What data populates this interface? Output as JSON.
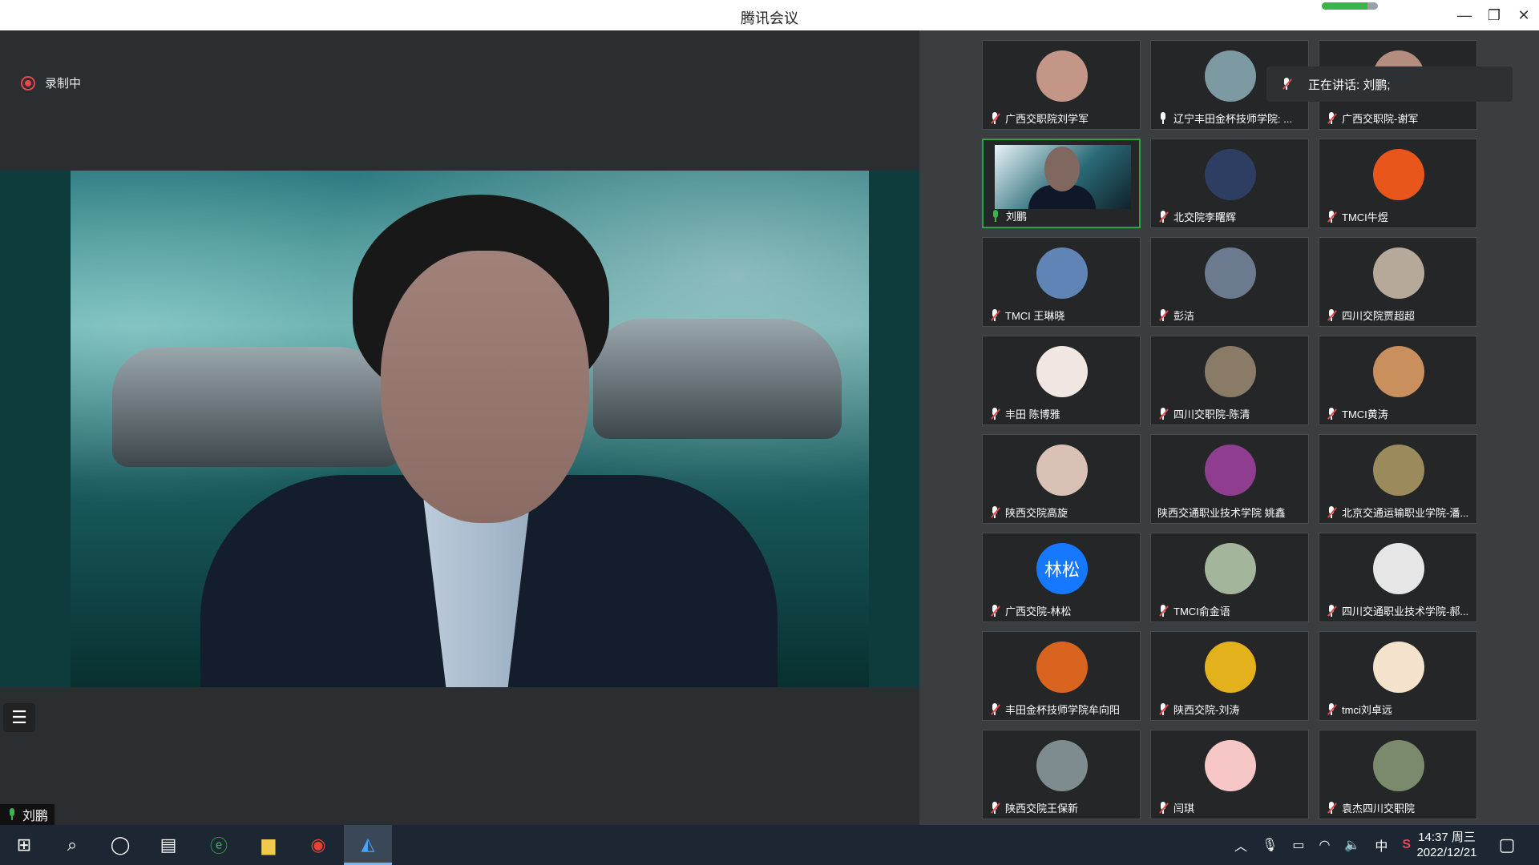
{
  "window": {
    "title": "腾讯会议",
    "network_level": 0.82,
    "accent": "#3bb54a"
  },
  "stage": {
    "recording_label": "录制中",
    "active_speaker": "刘鹏"
  },
  "speaking_banner": "正在讲话: 刘鹏;",
  "participants": [
    {
      "name": "广西交职院刘学军",
      "muted": true,
      "avatar": "child-photo",
      "color": "#c49688"
    },
    {
      "name": "辽宁丰田金杯技师学院: ...",
      "muted": false,
      "avatar": "lake-photo",
      "color": "#7d9aa3"
    },
    {
      "name": "广西交职院-谢军",
      "muted": true,
      "avatar": "person-photo",
      "color": "#b58d7e"
    },
    {
      "name": "刘鹏",
      "muted": false,
      "avatar": "camera-video",
      "color": "#2a6a77",
      "active": true
    },
    {
      "name": "北交院李曙辉",
      "muted": true,
      "avatar": "car-photo",
      "color": "#2e3e63"
    },
    {
      "name": "TMCI牛煜",
      "muted": true,
      "avatar": "orange-logo",
      "color": "#e8561b"
    },
    {
      "name": "TMCI 王琳晓",
      "muted": true,
      "avatar": "tower-photo",
      "color": "#5f84b5"
    },
    {
      "name": "彭洁",
      "muted": true,
      "avatar": "bus-photo",
      "color": "#6b7a8f"
    },
    {
      "name": "四川交院贾超超",
      "muted": true,
      "avatar": "cartoon-couple",
      "color": "#b7a99a"
    },
    {
      "name": "丰田 陈博雅",
      "muted": true,
      "avatar": "woman-portrait",
      "color": "#f0e6e2"
    },
    {
      "name": "四川交职院-陈清",
      "muted": true,
      "avatar": "outdoor-photo",
      "color": "#8a7b66"
    },
    {
      "name": "TMCI黄涛",
      "muted": true,
      "avatar": "sunglasses-portrait",
      "color": "#c98f5c"
    },
    {
      "name": "陕西交院高旋",
      "muted": true,
      "avatar": "woman-portrait",
      "color": "#d9c1b5"
    },
    {
      "name": "陕西交通职业技术学院 姚鑫",
      "muted": null,
      "avatar": "flower-photo",
      "color": "#8e3d8f"
    },
    {
      "name": "北京交通运输职业学院-潘...",
      "muted": true,
      "avatar": "garden-photo",
      "color": "#9a8a5c"
    },
    {
      "name": "广西交院-林松",
      "muted": true,
      "avatar": "initials",
      "initials": "林松",
      "color": "#1677ff"
    },
    {
      "name": "TMCI俞金语",
      "muted": true,
      "avatar": "painting",
      "color": "#a3b59a"
    },
    {
      "name": "四川交通职业技术学院-郝...",
      "muted": true,
      "avatar": "sketch-portrait",
      "color": "#e6e6e6"
    },
    {
      "name": "丰田金杯技师学院牟向阳",
      "muted": true,
      "avatar": "sunset-climb",
      "color": "#d9641f"
    },
    {
      "name": "陕西交院-刘涛",
      "muted": true,
      "avatar": "sunflower",
      "color": "#e3b11c"
    },
    {
      "name": "tmci刘卓远",
      "muted": true,
      "avatar": "sheep-cartoon",
      "color": "#f4e2cc"
    },
    {
      "name": "陕西交院王保新",
      "muted": true,
      "avatar": "landscape-photo",
      "color": "#7e8c8f"
    },
    {
      "name": "闫琪",
      "muted": true,
      "avatar": "pink-cartoon",
      "color": "#f6c7c6"
    },
    {
      "name": "袁杰四川交职院",
      "muted": true,
      "avatar": "person-outdoor",
      "color": "#7b8a6d"
    }
  ],
  "taskbar": {
    "apps": [
      {
        "icon": "windows-start-icon"
      },
      {
        "icon": "search-icon"
      },
      {
        "icon": "cortana-icon"
      },
      {
        "icon": "task-view-icon"
      },
      {
        "icon": "browser-icon"
      },
      {
        "icon": "file-explorer-icon"
      },
      {
        "icon": "chrome-icon"
      },
      {
        "icon": "tencent-meeting-icon"
      }
    ],
    "ime": "中",
    "time": "14:37 周三",
    "date": "2022/12/21"
  }
}
